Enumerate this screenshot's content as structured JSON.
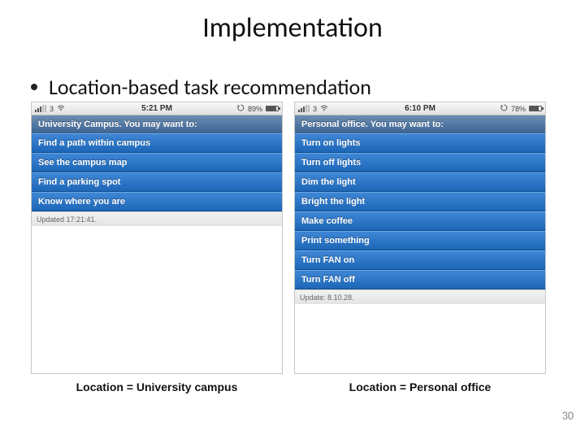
{
  "title": "Implementation",
  "bullet": "Location-based task recommendation",
  "page_number": "30",
  "phones": [
    {
      "status": {
        "carrier": "3",
        "time": "5:21 PM",
        "battery_pct": "89%",
        "battery_fill": "89%"
      },
      "location_header": "University Campus. You may want to:",
      "tasks": [
        "Find a path within campus",
        "See the campus map",
        "Find a parking spot",
        "Know where you are"
      ],
      "footer": "Updated 17:21:41.",
      "caption": "Location = University campus"
    },
    {
      "status": {
        "carrier": "3",
        "time": "6:10 PM",
        "battery_pct": "78%",
        "battery_fill": "78%"
      },
      "location_header": "Personal office. You may want to:",
      "tasks": [
        "Turn on lights",
        "Turn off lights",
        "Dim the light",
        "Bright the light",
        "Make coffee",
        "Print something",
        "Turn FAN on",
        "Turn FAN off"
      ],
      "footer": "Update: 8.10.28.",
      "caption": "Location = Personal office"
    }
  ]
}
